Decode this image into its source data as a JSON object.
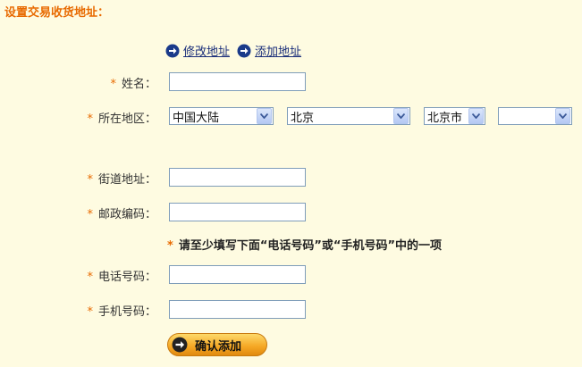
{
  "page": {
    "title": "设置交易收货地址："
  },
  "actions": {
    "modify_address": "修改地址",
    "add_address": "添加地址"
  },
  "form": {
    "required_mark": "*",
    "name_label": "姓名：",
    "name_value": "",
    "region_label": "所在地区：",
    "region": {
      "country": "中国大陆",
      "province": "北京",
      "city": "北京市",
      "district": ""
    },
    "street_label": "街道地址：",
    "street_value": "",
    "postcode_label": "邮政编码：",
    "postcode_value": "",
    "phone_notice": "请至少填写下面“电话号码”或“手机号码”中的一项",
    "phone_label": "电话号码：",
    "phone_value": "",
    "mobile_label": "手机号码：",
    "mobile_value": ""
  },
  "submit": {
    "label": "确认添加"
  },
  "icons": {
    "link_arrow": "arrow-right-circle-icon",
    "dropdown": "chevron-down-icon"
  },
  "colors": {
    "background": "#fefbe1",
    "title": "#e86a00",
    "required": "#e86a00",
    "link": "#1a2e7a",
    "button": "#f5a623"
  }
}
